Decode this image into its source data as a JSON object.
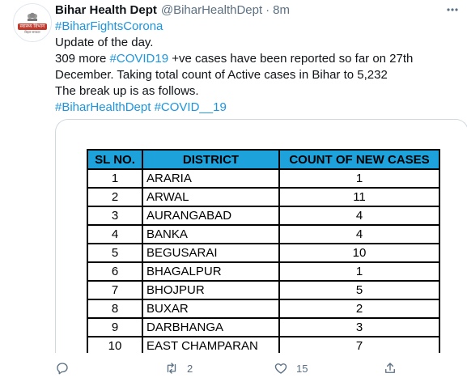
{
  "tweet": {
    "display_name": "Bihar Health Dept",
    "handle": "@BiharHealthDept",
    "separator": "·",
    "time": "8m",
    "avatar": {
      "logo_text": "स्वास्थ्य विभाग",
      "logo_sub": "बिहार सरकार"
    },
    "lines": {
      "hashtag1": "#BiharFightsCorona",
      "line2": "Update of the day.",
      "line3_prefix": "309 more ",
      "line3_tag": "#COVID19",
      "line3_suffix": " +ve cases have been reported so far on 27th",
      "line4": "December. Taking total count of Active cases in Bihar to 5,232",
      "line5": "The break up is as follows.",
      "tag_a": "#BiharHealthDept",
      "tag_b": "#COVID__19"
    }
  },
  "table": {
    "headers": [
      "SL NO.",
      "DISTRICT",
      "COUNT OF NEW CASES"
    ],
    "rows": [
      [
        "1",
        "ARARIA",
        "1"
      ],
      [
        "2",
        "ARWAL",
        "11"
      ],
      [
        "3",
        "AURANGABAD",
        "4"
      ],
      [
        "4",
        "BANKA",
        "4"
      ],
      [
        "5",
        "BEGUSARAI",
        "10"
      ],
      [
        "6",
        "BHAGALPUR",
        "1"
      ],
      [
        "7",
        "BHOJPUR",
        "5"
      ],
      [
        "8",
        "BUXAR",
        "2"
      ],
      [
        "9",
        "DARBHANGA",
        "3"
      ],
      [
        "10",
        "EAST CHAMPARAN",
        "7"
      ]
    ]
  },
  "actions": {
    "retweet_count": "2",
    "like_count": "15"
  },
  "colors": {
    "link": "#1b95e0",
    "header_fill": "#1ea2dc",
    "muted": "#5b7083"
  }
}
